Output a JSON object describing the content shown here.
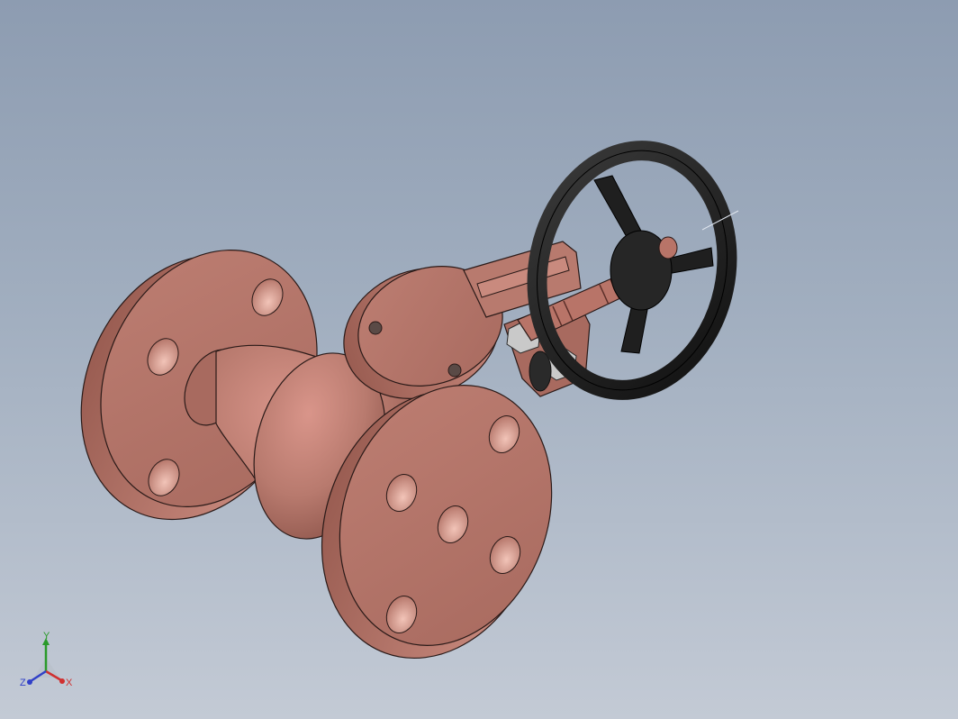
{
  "colors": {
    "background_top": "#8d9cb1",
    "background_bottom": "#c3cad5",
    "valve_body": "#b87a6e",
    "valve_shadow": "#8a5248",
    "handwheel": "#1f1f1f"
  },
  "model": {
    "part": "globe-valve-assembly",
    "components": [
      "inlet-flange",
      "valve-body",
      "outlet-flange",
      "bonnet-flange",
      "yoke",
      "stem",
      "packing-nuts",
      "handwheel"
    ]
  },
  "triad": {
    "x_label": "X",
    "y_label": "Y",
    "z_label": "Z",
    "x_color": "#d03030",
    "y_color": "#2a9a2a",
    "z_color": "#3040c8"
  }
}
